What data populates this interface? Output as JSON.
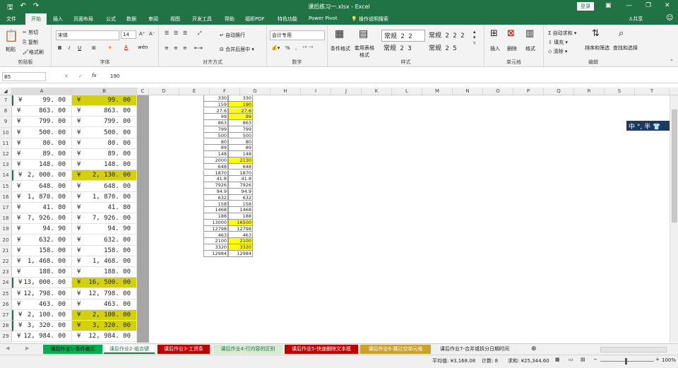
{
  "window": {
    "title": "课后练习一.xlsx - Excel",
    "login": "登录",
    "share": "共享"
  },
  "qat": {
    "save": "🖫",
    "undo": "↶",
    "redo": "↷"
  },
  "tabs": [
    "文件",
    "开始",
    "插入",
    "页面布局",
    "公式",
    "数据",
    "审阅",
    "视图",
    "开发工具",
    "帮助",
    "福昕PDF",
    "特色功能",
    "Power Pivot",
    "操作说明搜索"
  ],
  "ribbon": {
    "clipboard": {
      "label": "剪贴板",
      "paste": "粘贴",
      "cut": "剪切",
      "copy": "复制",
      "format_painter": "格式刷"
    },
    "font": {
      "label": "字体",
      "name": "宋体",
      "size": "14",
      "grow": "A⁺",
      "shrink": "A⁻",
      "bold": "B",
      "italic": "I",
      "underline": "U"
    },
    "alignment": {
      "label": "对齐方式",
      "wrap": "自动换行",
      "merge": "合并后居中"
    },
    "number": {
      "label": "数字",
      "format": "会计专用",
      "pct": "%",
      "comma": ","
    },
    "styles": {
      "label": "样式",
      "cond": "条件格式",
      "table": "套用表格格式",
      "cells": [
        "常规 2 2",
        "常规 2 2 2",
        "常规 2 3",
        "常规 2 5"
      ]
    },
    "cells": {
      "label": "单元格",
      "insert": "插入",
      "delete": "删除",
      "format": "格式"
    },
    "editing": {
      "label": "编辑",
      "autosum": "自动求和",
      "fill": "填充",
      "clear": "清除",
      "sort": "排序和筛选",
      "find": "查找和选择"
    }
  },
  "formula_bar": {
    "name_box": "B5",
    "fx": "fx",
    "value": "190"
  },
  "columns": [
    "A",
    "B",
    "C",
    "D",
    "E",
    "F",
    "G",
    "H",
    "I",
    "J",
    "K",
    "L",
    "M",
    "N",
    "O",
    "P",
    "Q",
    "R",
    "S",
    "T"
  ],
  "rows": [
    {
      "n": "7",
      "a": "99. 00",
      "b": "99. 00",
      "hl": true
    },
    {
      "n": "8",
      "a": "863. 00",
      "b": "863. 00",
      "hl": false
    },
    {
      "n": "9",
      "a": "799. 00",
      "b": "799. 00",
      "hl": false
    },
    {
      "n": "10",
      "a": "500. 00",
      "b": "500. 00",
      "hl": false
    },
    {
      "n": "11",
      "a": "80. 00",
      "b": "80. 00",
      "hl": false
    },
    {
      "n": "12",
      "a": "89. 00",
      "b": "89. 00",
      "hl": false
    },
    {
      "n": "13",
      "a": "148. 00",
      "b": "148. 00",
      "hl": false
    },
    {
      "n": "14",
      "a": "2, 000. 00",
      "b": "2, 130. 00",
      "hl": true
    },
    {
      "n": "15",
      "a": "648. 00",
      "b": "648. 00",
      "hl": false
    },
    {
      "n": "16",
      "a": "1, 870. 00",
      "b": "1, 870. 00",
      "hl": false
    },
    {
      "n": "17",
      "a": "41. 80",
      "b": "41. 80",
      "hl": false
    },
    {
      "n": "18",
      "a": "7, 926. 00",
      "b": "7, 926. 00",
      "hl": false
    },
    {
      "n": "19",
      "a": "94. 90",
      "b": "94. 90",
      "hl": false
    },
    {
      "n": "20",
      "a": "632. 00",
      "b": "632. 00",
      "hl": false
    },
    {
      "n": "21",
      "a": "158. 00",
      "b": "158. 00",
      "hl": false
    },
    {
      "n": "22",
      "a": "1, 468. 00",
      "b": "1, 468. 00",
      "hl": false
    },
    {
      "n": "23",
      "a": "188. 00",
      "b": "188. 00",
      "hl": false
    },
    {
      "n": "24",
      "a": "13, 000. 00",
      "b": "16, 500. 00",
      "hl": true
    },
    {
      "n": "25",
      "a": "12, 798. 00",
      "b": "12, 798. 00",
      "hl": false
    },
    {
      "n": "26",
      "a": "463. 00",
      "b": "463. 00",
      "hl": false
    },
    {
      "n": "27",
      "a": "2, 100. 00",
      "b": "2, 100. 00",
      "hl": true
    },
    {
      "n": "28",
      "a": "3, 320. 00",
      "b": "3, 320. 00",
      "hl": true
    },
    {
      "n": "29",
      "a": "12, 984. 00",
      "b": "12, 984. 00",
      "hl": false
    }
  ],
  "yen": "¥",
  "float_table": [
    [
      "330",
      "330",
      false
    ],
    [
      "159",
      "190",
      true
    ],
    [
      "27.6",
      "27.6",
      true
    ],
    [
      "99",
      "99",
      true
    ],
    [
      "863",
      "863",
      false
    ],
    [
      "799",
      "799",
      false
    ],
    [
      "500",
      "500",
      false
    ],
    [
      "80",
      "80",
      false
    ],
    [
      "89",
      "89",
      false
    ],
    [
      "148",
      "148",
      false
    ],
    [
      "2000",
      "2130",
      true
    ],
    [
      "648",
      "648",
      false
    ],
    [
      "1870",
      "1870",
      false
    ],
    [
      "41.8",
      "41.8",
      false
    ],
    [
      "7926",
      "7926",
      false
    ],
    [
      "94.9",
      "94.9",
      false
    ],
    [
      "632",
      "632",
      false
    ],
    [
      "158",
      "158",
      false
    ],
    [
      "1468",
      "1468",
      false
    ],
    [
      "188",
      "188",
      false
    ],
    [
      "13000",
      "16500",
      true
    ],
    [
      "12798",
      "12798",
      false
    ],
    [
      "463",
      "463",
      false
    ],
    [
      "2100",
      "2100",
      true
    ],
    [
      "3320",
      "3320",
      true
    ],
    [
      "12984",
      "12984",
      false
    ]
  ],
  "sheets": [
    {
      "name": "课后作业1-条件格式",
      "bg": "#00b050",
      "color": "#000"
    },
    {
      "name": "课后作业2-组合键",
      "bg": "#ffffff",
      "color": "#217346"
    },
    {
      "name": "课后作业3-工资条",
      "bg": "#c00000",
      "color": "#fff"
    },
    {
      "name": "课后作业4-行内容的区别",
      "bg": "#d9ead3",
      "color": "#217346"
    },
    {
      "name": "课后作业5-快速删除文本框",
      "bg": "#c00000",
      "color": "#fff"
    },
    {
      "name": "课后作业6-跳过空单元格",
      "bg": "#c9a227",
      "color": "#fff"
    },
    {
      "name": "课后作业7-合并或拆分日期时间",
      "bg": "#f0f0f0",
      "color": "#222"
    }
  ],
  "status": {
    "average": "平均值: ¥3,168.08",
    "count": "计数: 8",
    "sum": "求和: ¥25,344.60",
    "zoom": "100%"
  },
  "ime": {
    "text": "中 °, 半 👕"
  }
}
